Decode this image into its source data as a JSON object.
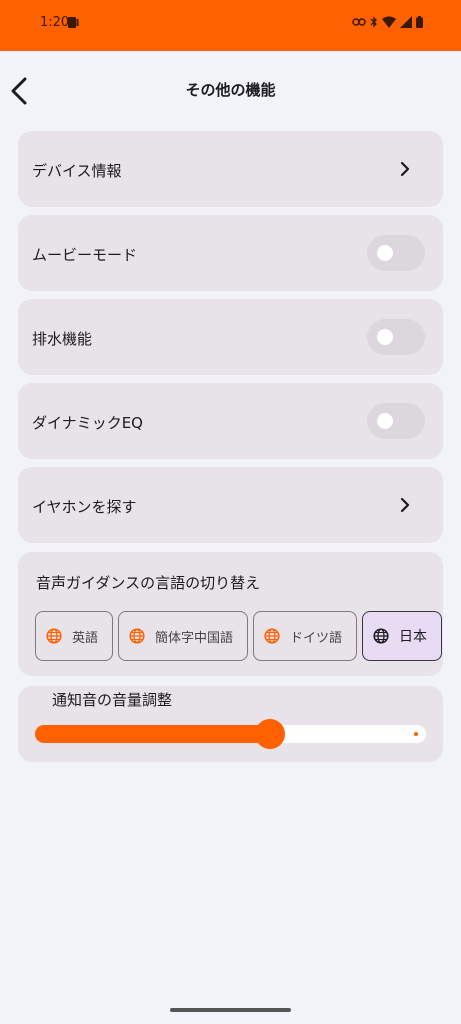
{
  "status_bar": {
    "time": "1:20",
    "icons": [
      "notification-icon",
      "link-icon",
      "bluetooth-icon",
      "wifi-icon",
      "signal-icon",
      "battery-icon"
    ]
  },
  "header": {
    "title": "その他の機能",
    "back_icon": "back-arrow-icon"
  },
  "rows": {
    "device_info": {
      "label": "デバイス情報",
      "type": "link"
    },
    "movie_mode": {
      "label": "ムービーモード",
      "type": "toggle",
      "on": false
    },
    "drain": {
      "label": "排水機能",
      "type": "toggle",
      "on": false
    },
    "dynamic_eq": {
      "label": "ダイナミックEQ",
      "type": "toggle",
      "on": false
    },
    "find_earbuds": {
      "label": "イヤホンを探す",
      "type": "link"
    }
  },
  "language": {
    "title": "音声ガイダンスの言語の切り替え",
    "options": [
      {
        "label": "英語",
        "selected": false
      },
      {
        "label": "簡体字中国語",
        "selected": false
      },
      {
        "label": "ドイツ語",
        "selected": false
      },
      {
        "label": "日本",
        "selected": true
      }
    ]
  },
  "volume": {
    "title": "通知音の音量調整",
    "level": 0.6
  },
  "colors": {
    "accent": "#ff6000",
    "card": "#e8e3e8",
    "background": "#f1f3f8",
    "selected_chip": "#e8dcf5"
  }
}
